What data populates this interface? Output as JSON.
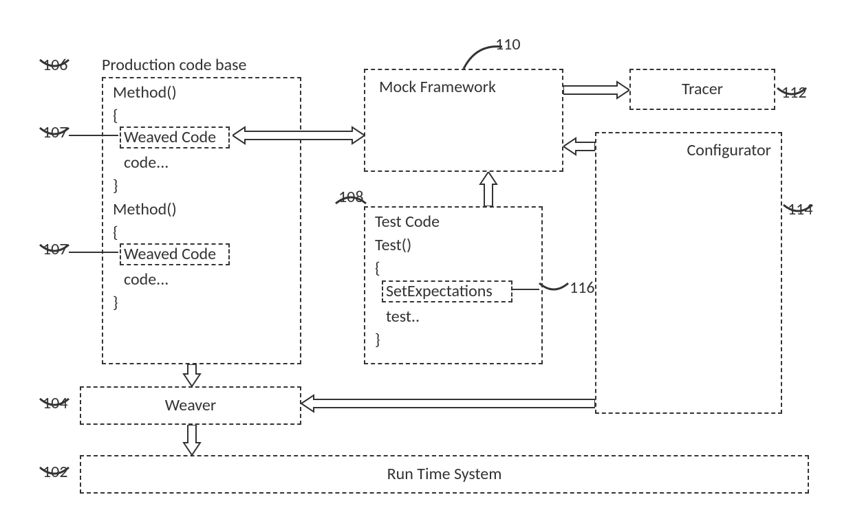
{
  "refs": {
    "r102": "102",
    "r104": "104",
    "r106": "106",
    "r107a": "107",
    "r107b": "107",
    "r108": "108",
    "r110": "110",
    "r112": "112",
    "r114": "114",
    "r116": "116"
  },
  "labels": {
    "production_title": "Production code base",
    "method1": "Method()",
    "brace_open1": "{",
    "weaved1": "Weaved Code",
    "code1": "code...",
    "brace_close1": "}",
    "method2": "Method()",
    "brace_open2": "{",
    "weaved2": "Weaved Code",
    "code2": "code...",
    "brace_close2": "}",
    "mock_framework": "Mock Framework",
    "tracer": "Tracer",
    "configurator": "Configurator",
    "test_code_title": "Test Code",
    "test_fn": "Test()",
    "test_brace_open": "{",
    "set_expectations": "SetExpectations",
    "test_line": "test..",
    "test_brace_close": "}",
    "weaver": "Weaver",
    "runtime": "Run Time System"
  }
}
